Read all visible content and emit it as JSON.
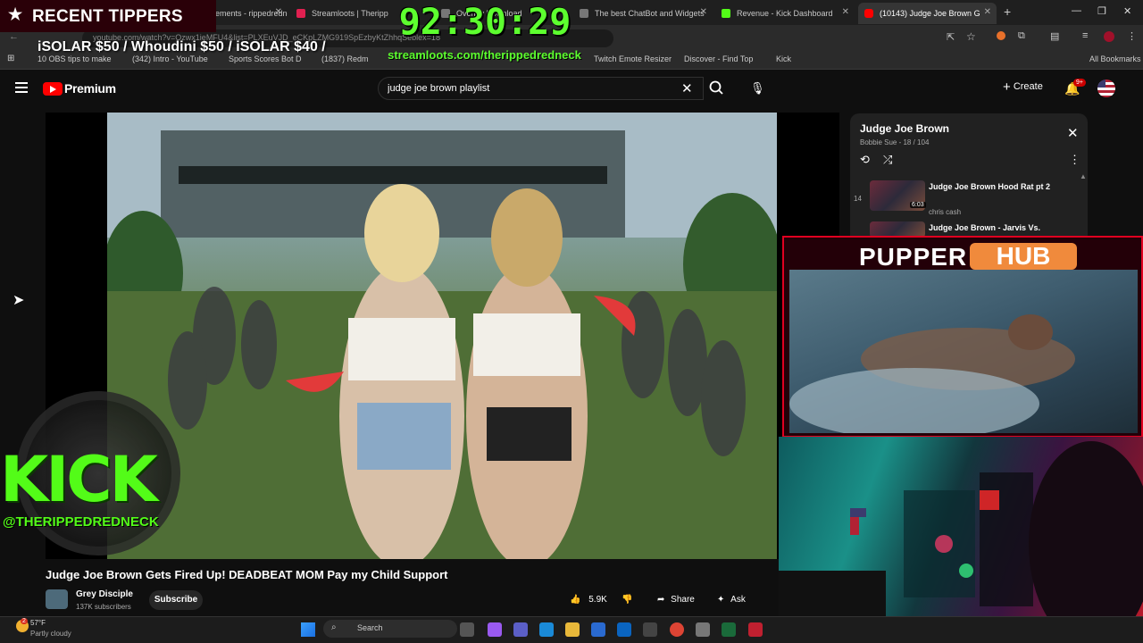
{
  "browser": {
    "tabs": [
      {
        "label": "StreamElements - rippedredne",
        "color": "#7a3cff"
      },
      {
        "label": "Streamloots | Theripp",
        "color": "#e02050"
      },
      {
        "label": "Overlay Download",
        "color": "#777777"
      },
      {
        "label": "The best ChatBot and Widgets",
        "color": "#777777"
      },
      {
        "label": "Revenue - Kick Dashboard",
        "color": "#53fc18"
      },
      {
        "label": "(10143) Judge Joe Brown G",
        "color": "#ff0000"
      }
    ],
    "url": "youtube.com/watch?v=Ozwx1ieMFU4&list=PLXEuVJD_eCKpLZMG919SpEzbyKtZhhqSeblex=18",
    "bookmarks": [
      "10 OBS tips to make",
      "(342) Intro - YouTube",
      "Sports Scores Bot D",
      "(1837) Redm",
      "Twitch Emote Resizer",
      "Discover - Find Top",
      "Kick",
      "All Bookmarks"
    ]
  },
  "overlay": {
    "recent_tippers": "RECENT TIPPERS",
    "ticker": "iSOLAR $50 / Whoudini $50 / iSOLAR $40 /",
    "timer": "92:30:29",
    "streamloots_url": "streamloots.com/therippedredneck",
    "kick_text": "KICK",
    "kick_handle": "@THERIPPEDREDNECK",
    "pupper": "PUPPER",
    "hub": "HUB"
  },
  "youtube": {
    "brand": "Premium",
    "search_value": "judge joe brown playlist",
    "create_label": "Create",
    "notif_count": "9+",
    "playlist": {
      "title": "Judge Joe Brown",
      "subtitle": "Bobbie Sue - 18 / 104",
      "items": [
        {
          "index": "14",
          "title": "Judge Joe Brown Hood Rat pt 2",
          "channel": "chris cash",
          "duration": "6:03"
        },
        {
          "index": "",
          "title": "Judge Joe Brown - Jarvis Vs.",
          "channel": "",
          "duration": ""
        }
      ]
    },
    "video": {
      "title": "Judge Joe Brown Gets Fired Up! DEADBEAT MOM Pay my Child Support",
      "channel": "Grey Disciple",
      "subscribers": "137K subscribers",
      "subscribe_label": "Subscribe",
      "likes": "5.9K",
      "share_label": "Share",
      "ask_label": "Ask"
    }
  },
  "taskbar": {
    "temperature": "57°F",
    "condition": "Partly cloudy",
    "search_placeholder": "Search",
    "weather_badge": "2"
  }
}
